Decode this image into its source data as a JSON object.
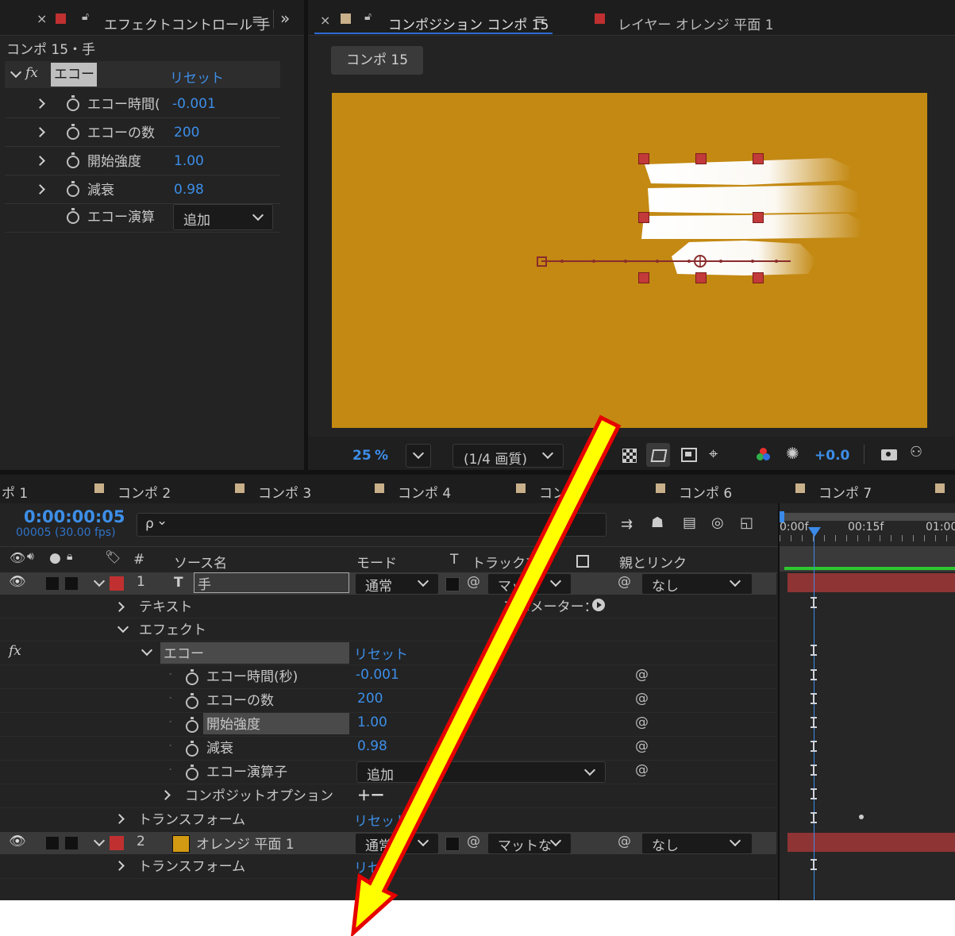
{
  "effect_controls": {
    "tab_title": "エフェクトコントロール 手",
    "subtitle": "コンポ 15・手",
    "fx_label": "fx",
    "effect_name": "エコー",
    "reset": "リセット",
    "params": [
      {
        "label": "エコー時間(",
        "value": "-0.001"
      },
      {
        "label": "エコーの数",
        "value": "200"
      },
      {
        "label": "開始強度",
        "value": "1.00"
      },
      {
        "label": "減衰",
        "value": "0.98"
      },
      {
        "label": "エコー演算",
        "value": "追加"
      }
    ],
    "expand_panels": "»"
  },
  "composition": {
    "close": "×",
    "tab_title": "コンポジション コンポ 15",
    "layer_tab": "レイヤー オレンジ 平面 1",
    "breadcrumb": "コンポ 15",
    "bg_color": "#c38912",
    "toolbar": {
      "zoom_value": "25",
      "zoom_unit": "%",
      "resolution": "(1/4 画質)",
      "exposure": "+0.0"
    }
  },
  "timeline": {
    "tabs": [
      "ポ 1",
      "コンポ 2",
      "コンポ 3",
      "コンポ 4",
      "コンポ",
      "コンポ 6",
      "コンポ 7"
    ],
    "timecode": "0:00:00:05",
    "frames": "00005 (30.00 fps)",
    "search_icon_text": "ρ",
    "search_caret": "⌄",
    "ruler": [
      "0:00f",
      "00:15f",
      "01:00"
    ],
    "headers": {
      "num": "#",
      "source": "ソース名",
      "mode": "モード",
      "t": "T",
      "track": "トラックマ",
      "parent": "親とリンク"
    },
    "layer1": {
      "num": "1",
      "type": "T",
      "name": "手",
      "mode": "通常",
      "track": "マッ",
      "parent": "なし"
    },
    "rows": {
      "text": "テキスト",
      "animator": "アニメーター：",
      "effect": "エフェクト",
      "fx": "fx",
      "echo": "エコー",
      "reset": "リセット",
      "p1": "エコー時間(秒)",
      "p1v": "-0.001",
      "p2": "エコーの数",
      "p2v": "200",
      "p3": "開始強度",
      "p3v": "1.00",
      "p4": "減衰",
      "p4v": "0.98",
      "p5": "エコー演算子",
      "p5v": "追加",
      "composite": "コンポジットオプション",
      "plusminus": "＋ー",
      "transform": "トランスフォーム",
      "reset2": "リセット",
      "reset3": "リセ"
    },
    "layer2": {
      "num": "2",
      "name": "オレンジ 平面 1",
      "mode": "通常",
      "track": "マットな",
      "parent": "なし",
      "swatch": "#d29a12"
    }
  },
  "colors": {
    "layer_red": "#c03030",
    "accent_blue": "#3d8ee8",
    "arrow_fill": "#ffff00",
    "arrow_outline": "#e60000"
  }
}
